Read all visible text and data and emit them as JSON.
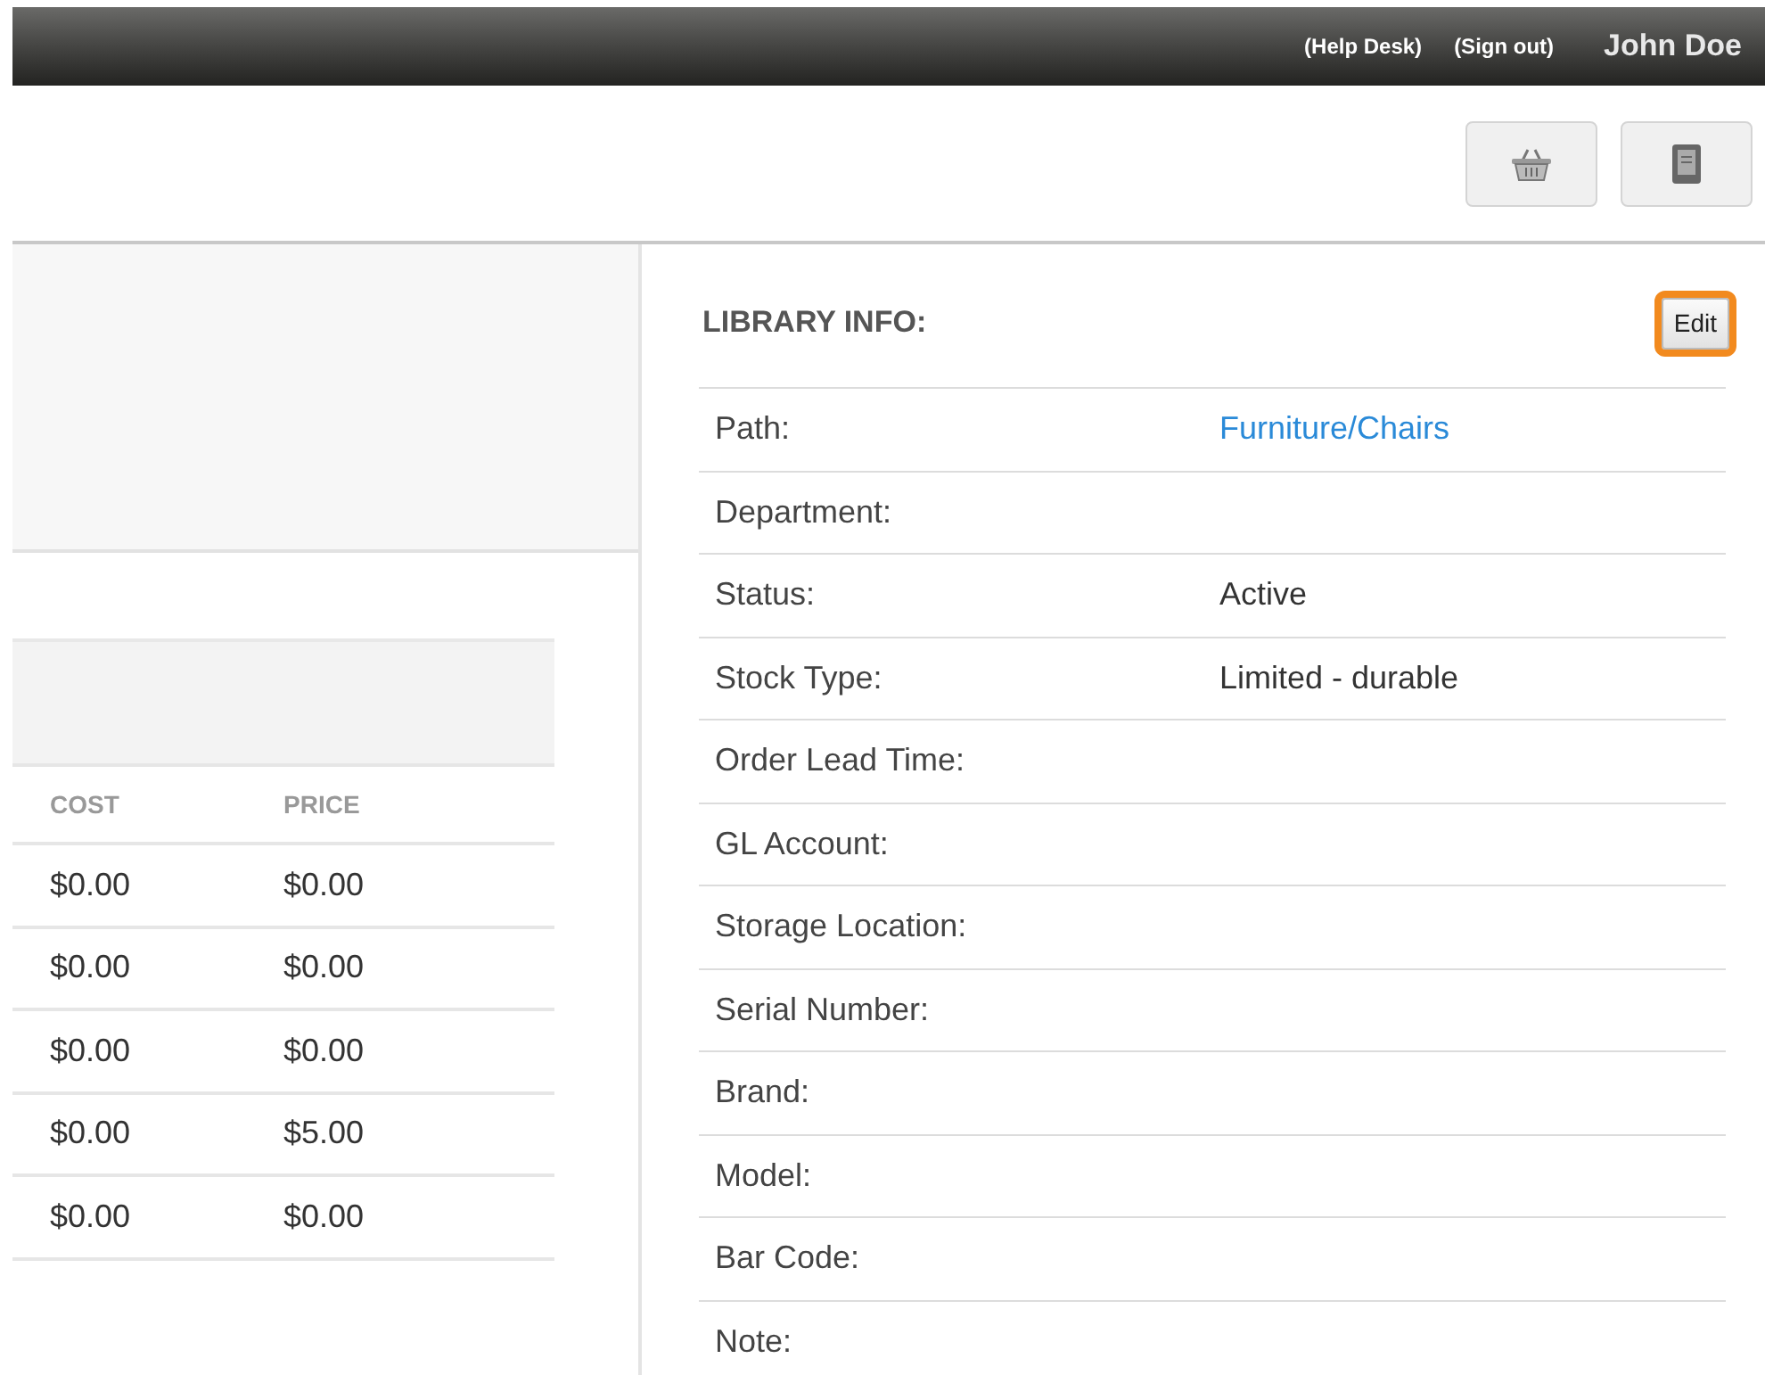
{
  "top_bar": {
    "links": [
      "(Help Desk)",
      "(Sign out)"
    ],
    "user": "John Doe"
  },
  "toolbar": {
    "buttons": [
      {
        "kind": "basket"
      },
      {
        "kind": "book"
      }
    ]
  },
  "price_table": {
    "columns": [
      "COST",
      "PRICE"
    ],
    "rows": [
      [
        "$0.00",
        "$0.00"
      ],
      [
        "$0.00",
        "$0.00"
      ],
      [
        "$0.00",
        "$0.00"
      ],
      [
        "$0.00",
        "$5.00"
      ],
      [
        "$0.00",
        "$0.00"
      ]
    ]
  },
  "library_info": {
    "title": "LIBRARY INFO:",
    "edit_button": {
      "label": "Edit",
      "highlighted": true
    },
    "fields": [
      {
        "label": "Path:",
        "value": "Furniture/Chairs",
        "kind": "link"
      },
      {
        "label": "Department:"
      },
      {
        "label": "Status:",
        "value": "Active",
        "kind": "text"
      },
      {
        "label": "Stock Type:",
        "value": "Limited - durable",
        "kind": "text"
      },
      {
        "label": "Order Lead Time:"
      },
      {
        "label": "GL Account:"
      },
      {
        "label": "Storage Location:"
      },
      {
        "label": "Serial Number:"
      },
      {
        "label": "Brand:"
      },
      {
        "label": "Model:"
      },
      {
        "label": "Bar Code:"
      },
      {
        "label": "Note:"
      }
    ]
  }
}
